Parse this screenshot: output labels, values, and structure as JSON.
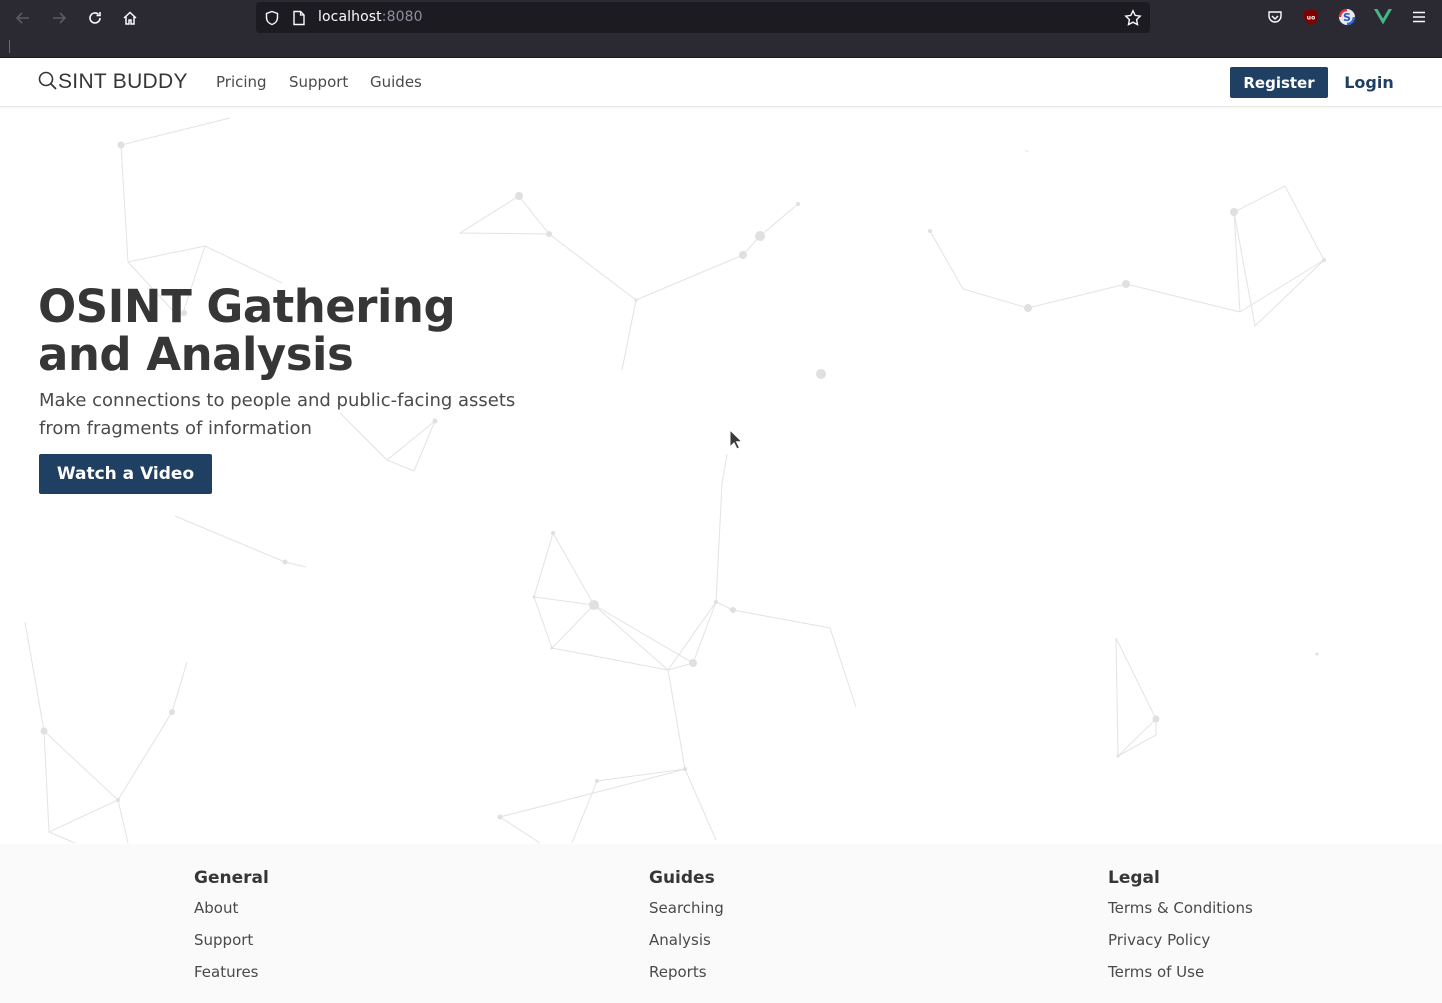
{
  "browser": {
    "url_host": "localhost",
    "url_port": ":8080"
  },
  "nav": {
    "brand": "SINT BUDDY",
    "links": [
      "Pricing",
      "Support",
      "Guides"
    ],
    "register_label": "Register",
    "login_label": "Login"
  },
  "hero": {
    "title_line1": "OSINT Gathering",
    "title_line2": "and Analysis",
    "subtitle_line1": "Make connections to people and public-facing assets",
    "subtitle_line2": "from fragments of information",
    "video_button": "Watch a Video"
  },
  "footer": {
    "columns": [
      {
        "heading": "General",
        "links": [
          "About",
          "Support",
          "Features"
        ]
      },
      {
        "heading": "Guides",
        "links": [
          "Searching",
          "Analysis",
          "Reports"
        ]
      },
      {
        "heading": "Legal",
        "links": [
          "Terms & Conditions",
          "Privacy Policy",
          "Terms of Use"
        ]
      }
    ]
  },
  "colors": {
    "brand_primary": "#1f3f63",
    "browser_chrome": "#2b2a33",
    "text_dark": "#363636",
    "footer_bg": "#fafafa"
  },
  "icons": {
    "browser_nav": [
      "back-arrow-icon",
      "forward-arrow-icon",
      "reload-icon",
      "home-icon"
    ],
    "url_bar": [
      "shield-icon",
      "page-icon",
      "bookmark-star-icon"
    ],
    "extensions": [
      "pocket-icon",
      "ublock-icon",
      "extension-s-icon",
      "vue-devtools-icon",
      "menu-icon"
    ],
    "brand": "magnifier-icon"
  }
}
